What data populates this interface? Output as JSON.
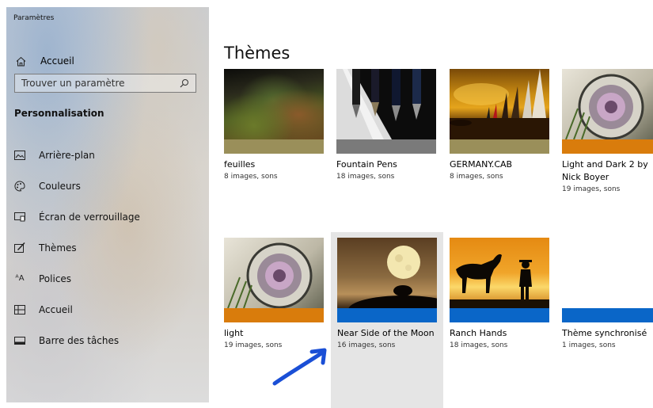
{
  "app": {
    "title": "Paramètres"
  },
  "sidebar": {
    "home_label": "Accueil",
    "search_placeholder": "Trouver un paramètre",
    "section_title": "Personnalisation",
    "items": [
      {
        "label": "Arrière-plan",
        "icon": "picture-icon"
      },
      {
        "label": "Couleurs",
        "icon": "palette-icon"
      },
      {
        "label": "Écran de verrouillage",
        "icon": "lock-screen-icon"
      },
      {
        "label": "Thèmes",
        "icon": "brush-icon"
      },
      {
        "label": "Polices",
        "icon": "font-icon"
      },
      {
        "label": "Accueil",
        "icon": "start-icon"
      },
      {
        "label": "Barre des tâches",
        "icon": "taskbar-icon"
      }
    ]
  },
  "main": {
    "title": "Thèmes",
    "themes": [
      {
        "name": "feuilles",
        "sub": "8 images, sons",
        "accent": "#9a8f5a"
      },
      {
        "name": "Fountain Pens",
        "sub": "18 images, sons",
        "accent": "#7a7a7a"
      },
      {
        "name": "GERMANY.CAB",
        "sub": "8 images, sons",
        "accent": "#9a8f5a"
      },
      {
        "name": "Light and Dark 2 by Nick Boyer",
        "sub": "19 images, sons",
        "accent": "#d97c0c"
      },
      {
        "name": "light",
        "sub": "19 images, sons",
        "accent": "#d97c0c"
      },
      {
        "name": "Near Side of the Moon",
        "sub": "16 images, sons",
        "accent": "#0a66c8",
        "selected": true
      },
      {
        "name": "Ranch Hands",
        "sub": "18 images, sons",
        "accent": "#0a66c8"
      },
      {
        "name": "Thème synchronisé",
        "sub": "1 images, sons",
        "accent": "#0a66c8"
      }
    ]
  },
  "annotation": {
    "arrow_color": "#1a4fd6"
  }
}
